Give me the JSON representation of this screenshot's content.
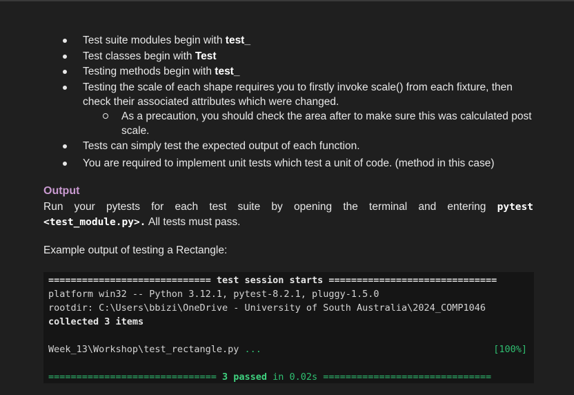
{
  "bullets": [
    {
      "text": "Test suite modules begin with ",
      "bold": "test_"
    },
    {
      "text": "Test classes begin with ",
      "bold": "Test"
    },
    {
      "text": "Testing methods begin with ",
      "bold": "test_"
    },
    {
      "text": "Testing the scale of each shape requires you to firstly invoke scale() from each fixture, then check their associated attributes which were changed."
    },
    {
      "text": "As a precaution, you should check the area after to make sure this was calculated post scale."
    },
    {
      "text": "Tests can simply test the expected output of each function."
    },
    {
      "text": "You are required to implement unit tests which test a unit of code. (method in this case)"
    }
  ],
  "output": {
    "heading": "Output",
    "para_text": "Run your pytests for each test suite by opening the terminal and entering ",
    "para_code": "pytest <test_module.py>.",
    "para_tail": " All tests must pass.",
    "example": "Example output of testing a Rectangle:"
  },
  "terminal": {
    "session_left": "=============================",
    "session_title": " test session starts ",
    "session_right": "==============================",
    "platform": "platform win32 -- Python 3.12.1, pytest-8.2.1, pluggy-1.5.0",
    "rootdir": "rootdir: C:\\Users\\bbizi\\OneDrive - University of South Australia\\2024_COMP1046",
    "collected": "collected 3 items",
    "test_file": "Week_13\\Workshop\\test_rectangle.py",
    "test_dots": " ...",
    "progress": "[100%]",
    "summary_left": "==============================",
    "summary_passed": " 3 passed",
    "summary_time": " in 0.02s ",
    "summary_right": "=============================="
  }
}
